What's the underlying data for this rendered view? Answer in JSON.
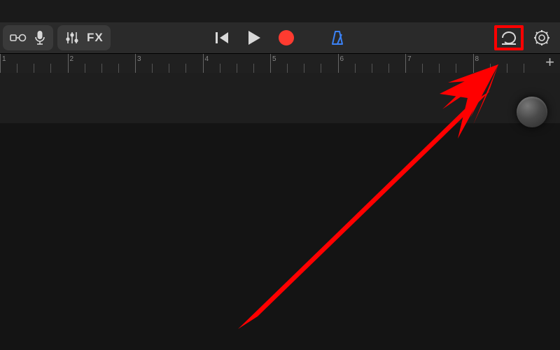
{
  "toolbar": {
    "left": {
      "tracks_icon": "tracks-view",
      "mic_icon": "microphone",
      "mixer_icon": "mixer-faders",
      "fx_label": "FX"
    },
    "center": {
      "go_to_start_icon": "go-to-beginning",
      "play_icon": "play",
      "record_icon": "record",
      "record_color": "#ff3b30",
      "metronome_icon": "metronome",
      "metronome_color": "#3b82f6"
    },
    "right": {
      "loop_icon": "loop",
      "settings_icon": "gear"
    }
  },
  "ruler": {
    "start_bar": 1,
    "visible_bars": [
      1,
      2,
      3,
      4,
      5,
      6,
      7,
      8
    ],
    "subdivisions_per_bar": 4,
    "add_label": "+"
  },
  "annotation": {
    "highlight_target": "loop-button",
    "highlight_color": "#ff0000",
    "arrow_color": "#ff0000"
  }
}
